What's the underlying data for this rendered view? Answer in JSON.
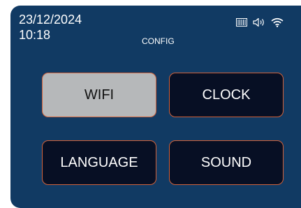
{
  "status": {
    "date": "23/12/2024",
    "time": "10:18",
    "icons": [
      "battery-icon",
      "speaker-icon",
      "wifi-signal-icon"
    ]
  },
  "screen": {
    "title": "CONFIG"
  },
  "menu": {
    "buttons": [
      {
        "label": "WIFI",
        "selected": true
      },
      {
        "label": "CLOCK",
        "selected": false
      },
      {
        "label": "LANGUAGE",
        "selected": false
      },
      {
        "label": "SOUND",
        "selected": false
      }
    ]
  },
  "colors": {
    "panel_background": "#113a63",
    "button_background": "#070f24",
    "button_border": "#d2623a",
    "selected_button_background": "#b6b8ba",
    "text": "#ffffff",
    "selected_text": "#111111"
  }
}
